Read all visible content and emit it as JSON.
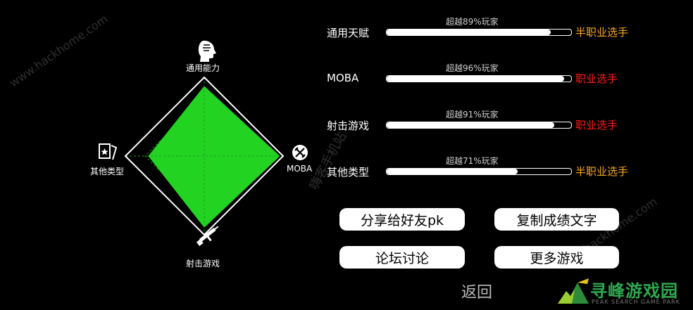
{
  "radar": {
    "labels": {
      "top": "通用能力",
      "right": "MOBA",
      "bottom": "射击游戏",
      "left": "其他类型"
    },
    "values": [
      0.89,
      0.96,
      0.91,
      0.71
    ],
    "fill_color": "#22d322"
  },
  "stats": [
    {
      "name": "通用天赋",
      "percentile_text": "超越89%玩家",
      "percentile": 0.89,
      "rank": "半职业选手",
      "rank_color": "#f5a623"
    },
    {
      "name": "MOBA",
      "percentile_text": "超越96%玩家",
      "percentile": 0.96,
      "rank": "职业选手",
      "rank_color": "#ff1a1a"
    },
    {
      "name": "射击游戏",
      "percentile_text": "超越91%玩家",
      "percentile": 0.91,
      "rank": "职业选手",
      "rank_color": "#ff1a1a"
    },
    {
      "name": "其他类型",
      "percentile_text": "超越71%玩家",
      "percentile": 0.71,
      "rank": "半职业选手",
      "rank_color": "#f5a623"
    }
  ],
  "buttons": {
    "share": "分享给好友pk",
    "copy": "复制成绩文字",
    "forum": "论坛讨论",
    "more": "更多游戏"
  },
  "back_label": "返回",
  "watermarks": {
    "hackhome_1": "www.hackhome.com",
    "hackhome_2": "www.hackhome.com",
    "center": "嗨客手机站"
  },
  "logo": {
    "title": "寻峰游戏园",
    "subtitle": "PEAK SEARCH GAME PARK"
  },
  "icons": {
    "top": "head-profile-icon",
    "right": "crossed-swords-icon",
    "bottom": "rifle-icon",
    "left": "cards-icon"
  }
}
